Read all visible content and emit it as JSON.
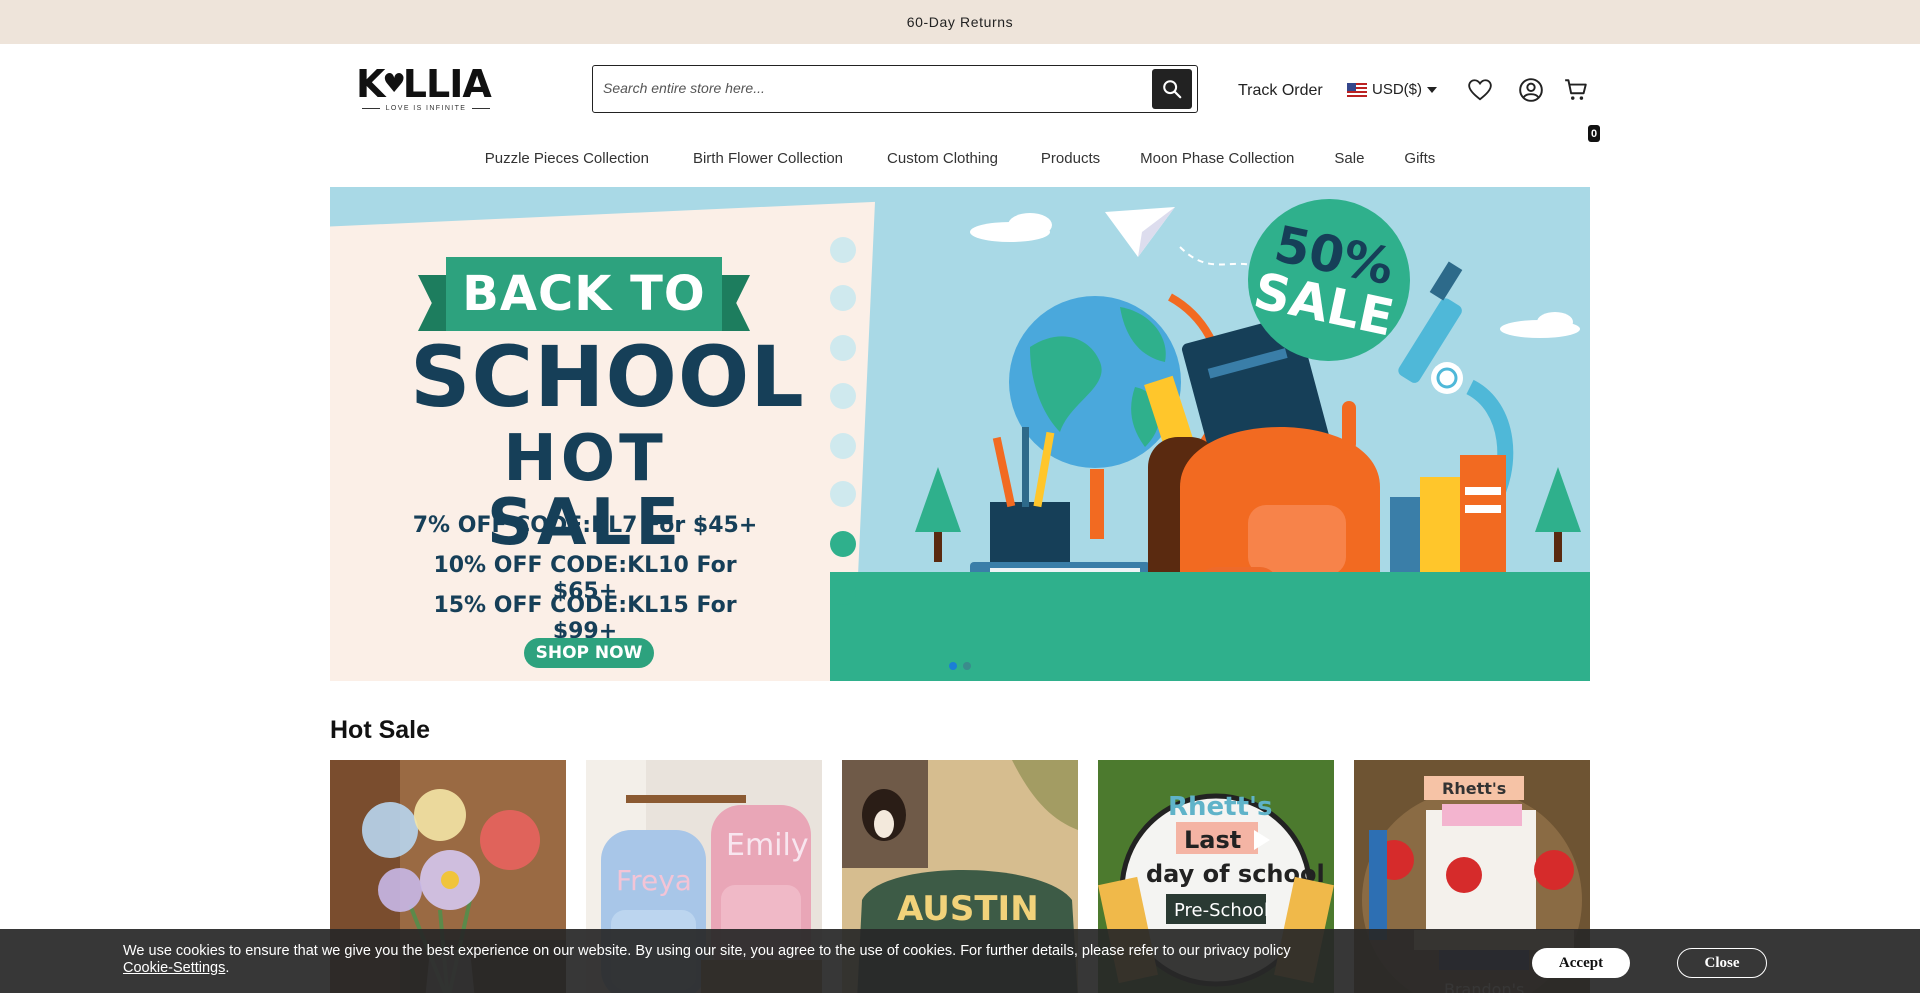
{
  "announcement": "60-Day Returns",
  "logo": {
    "word_left": "K",
    "word_right": "LLIA",
    "tagline": "LOVE IS INFINITE"
  },
  "search": {
    "placeholder": "Search entire store here...",
    "icon": "search-icon"
  },
  "header": {
    "track_order": "Track Order",
    "currency": "USD($)",
    "wishlist_icon": "heart-icon",
    "account_icon": "user-icon",
    "cart_icon": "cart-icon",
    "cart_count": "0"
  },
  "nav": {
    "items": [
      {
        "label": "Puzzle Pieces Collection"
      },
      {
        "label": "Birth Flower Collection"
      },
      {
        "label": "Custom Clothing"
      },
      {
        "label": "Products"
      },
      {
        "label": "Moon Phase Collection"
      },
      {
        "label": "Sale"
      },
      {
        "label": "Gifts"
      }
    ]
  },
  "hero": {
    "ribbon": "BACK TO",
    "headline": "SCHOOL",
    "subheadline": "HOT  SALE",
    "codes": [
      "7% OFF  CODE:KL7  For $45+",
      "10% OFF  CODE:KL10  For $65+",
      "15% OFF  CODE:KL15  For $99+"
    ],
    "cta": "SHOP NOW",
    "badge_pct": "50%",
    "badge_word": "SALE",
    "slide_count": 2,
    "active_slide": 1,
    "colors": {
      "paper": "#fbefe7",
      "sky": "#a9d9e6",
      "green": "#2da27e",
      "navy": "#163f58",
      "orange": "#f26a21"
    }
  },
  "hot_sale": {
    "title": "Hot Sale",
    "products": [
      {
        "name": "glass-flower-bouquet"
      },
      {
        "name": "name-backpacks"
      },
      {
        "name": "custom-dog-sweatshirt"
      },
      {
        "name": "last-day-of-school-sign"
      },
      {
        "name": "teacher-apple-sign"
      }
    ]
  },
  "cookie": {
    "text": "We use cookies to ensure that we give you the best experience on our website. By using our site, you agree to the use of cookies. For further details, please refer to our privacy policy ",
    "link": "Cookie-Settings",
    "period": ".",
    "accept": "Accept",
    "close": "Close"
  }
}
